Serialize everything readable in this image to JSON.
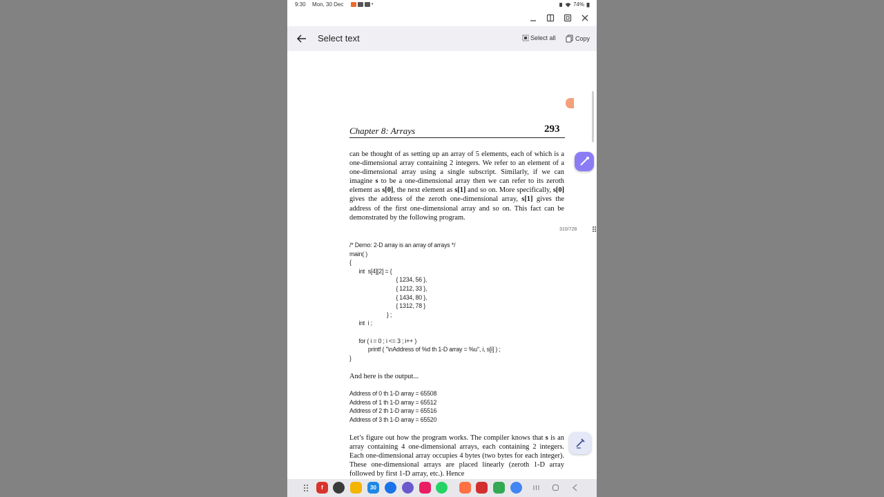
{
  "status_bar": {
    "time": "9:30",
    "date": "Mon, 30 Dec",
    "battery": "74%"
  },
  "app_bar": {
    "title": "Select text",
    "select_all_label": "Select all",
    "copy_label": "Copy"
  },
  "document": {
    "chapter_title": "Chapter 8: Arrays",
    "page_number": "293",
    "page_counter": "310/728",
    "para1_parts": [
      "can be thought of as setting up an array of 5 elements, each of which is a one-dimensional array containing 2 integers. We refer to an element of a one-dimensional array using a single subscript. Similarly, if we can imagine ",
      "s",
      " to be a one-dimensional array then we can refer to its zeroth element as ",
      "s[0]",
      ", the next element as ",
      "s[1]",
      " and so on. More specifically, ",
      "s[0]",
      " gives the address of the zeroth one-dimensional array, ",
      "s[1]",
      " gives the address of the first one-dimensional array and so on. This fact can be demonstrated by the following program."
    ],
    "code_lines": [
      "/* Demo: 2-D array is an array of arrays */",
      "main( )",
      "{",
      "      int  s[4][2] = {",
      "                              { 1234, 56 },",
      "                              { 1212, 33 },",
      "                              { 1434, 80 },",
      "                              { 1312, 78 }",
      "                        } ;",
      "      int  i ;",
      "",
      "      for ( i = 0 ; i <= 3 ; i++ )",
      "            printf ( \"\\nAddress of %d th 1-D array = %u\", i, s[i] ) ;",
      "}"
    ],
    "output_intro": "And here is the output...",
    "output_lines": [
      "Address of 0 th 1-D array = 65508",
      "Address of 1 th 1-D array = 65512",
      "Address of 2 th 1-D array = 65516",
      "Address of 3 th 1-D array = 65520"
    ],
    "para2_parts": [
      "Let’s figure out how the program works. The compiler knows that ",
      "s",
      " is an array containing 4 one-dimensional arrays, each containing 2 integers. Each one-dimensional array occupies 4 bytes (two bytes for each integer). These one-dimensional arrays are placed linearly (zeroth 1-D array followed by first 1-D array, etc.). Hence"
    ]
  },
  "taskbar_icons": [
    {
      "name": "apps-grid-icon",
      "color": "#e8e8ec"
    },
    {
      "name": "flipboard-icon",
      "color": "#d9342b"
    },
    {
      "name": "camera-app-icon",
      "color": "#3a3a3a"
    },
    {
      "name": "files-icon",
      "color": "#f4b400"
    },
    {
      "name": "calendar-icon",
      "color": "#1e88e5"
    },
    {
      "name": "messages-icon",
      "color": "#1a73e8"
    },
    {
      "name": "chat-icon",
      "color": "#6a5acd"
    },
    {
      "name": "screen-recorder-icon",
      "color": "#e91e63"
    },
    {
      "name": "whatsapp-icon",
      "color": "#25d366"
    },
    {
      "name": "reader-icon",
      "color": "#ff7043"
    },
    {
      "name": "pdf-reader-icon",
      "color": "#d32f2f"
    },
    {
      "name": "drive-icon",
      "color": "#34a853"
    },
    {
      "name": "chrome-icon",
      "color": "#4285f4"
    }
  ]
}
